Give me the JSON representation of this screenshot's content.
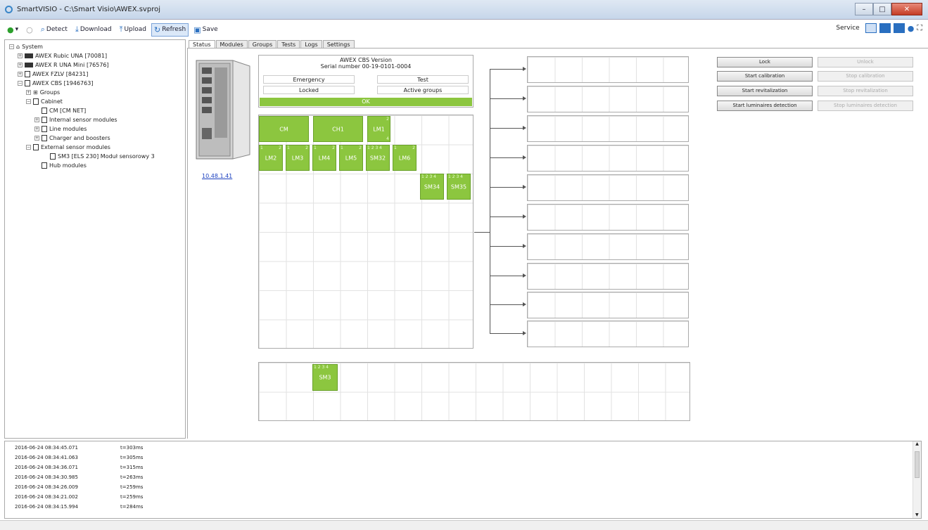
{
  "window": {
    "title": "SmartVISIO - C:\\Smart Visio\\AWEX.svproj"
  },
  "toolbar": {
    "buttons": [
      {
        "label": "",
        "icon": "add-icon"
      },
      {
        "label": "",
        "icon": "remove-icon"
      },
      {
        "label": "Detect",
        "icon": "detect-icon"
      },
      {
        "label": "Download",
        "icon": "download-icon"
      },
      {
        "label": "Upload",
        "icon": "upload-icon"
      },
      {
        "label": "Refresh",
        "icon": "refresh-icon"
      },
      {
        "label": "Save",
        "icon": "save-icon"
      }
    ],
    "service_label": "Service"
  },
  "tree": {
    "items": [
      {
        "label": "System"
      },
      {
        "label": "AWEX Rubic UNA [70081]"
      },
      {
        "label": "AWEX R UNA Mini [76576]"
      },
      {
        "label": "AWEX FZLV [84231]"
      },
      {
        "label": "AWEX CBS [1946763]"
      },
      {
        "label": "Groups"
      },
      {
        "label": "Cabinet"
      },
      {
        "label": "CM [CM NET]"
      },
      {
        "label": "Internal sensor modules"
      },
      {
        "label": "Line modules"
      },
      {
        "label": "Charger and boosters"
      },
      {
        "label": "External sensor modules"
      },
      {
        "label": "SM3 [ELS 230] Moduł sensorowy 3"
      },
      {
        "label": "Hub modules"
      }
    ]
  },
  "tabs": [
    "Status",
    "Modules",
    "Groups",
    "Tests",
    "Logs",
    "Settings"
  ],
  "status": {
    "device_line": "AWEX CBS   Version",
    "serial_line": "Serial number 00-19-0101-0004",
    "emergency": "Emergency",
    "test": "Test",
    "locked": "Locked",
    "active_groups": "Active groups",
    "ok": "OK",
    "ip": "10.48.1.41"
  },
  "modules": {
    "row1": [
      {
        "label": "CM",
        "tl": "",
        "tr": "",
        "br": ""
      },
      {
        "label": "CH1",
        "tl": "",
        "tr": "",
        "br": ""
      },
      {
        "label": "LM1",
        "tl": "",
        "tr": "2",
        "br": "4"
      }
    ],
    "row2": [
      {
        "label": "LM2",
        "tl": "1",
        "tr": "2"
      },
      {
        "label": "LM3",
        "tl": "1",
        "tr": "2"
      },
      {
        "label": "LM4",
        "tl": "1",
        "tr": "2"
      },
      {
        "label": "LM5",
        "tl": "1",
        "tr": "2"
      },
      {
        "label": "SM32",
        "tl": "1 2 3 4",
        "tr": ""
      },
      {
        "label": "LM6",
        "tl": "1",
        "tr": "2"
      }
    ],
    "row3": [
      {
        "label": "SM34",
        "tl": "1 2 3 4",
        "tr": ""
      },
      {
        "label": "SM35",
        "tl": "1 2 3 4",
        "tr": ""
      }
    ],
    "external": [
      {
        "label": "SM3",
        "tl": "1 2 3 4",
        "tr": ""
      }
    ]
  },
  "commands": [
    {
      "label": "Lock",
      "enabled": true
    },
    {
      "label": "Unlock",
      "enabled": false
    },
    {
      "label": "Start calibration",
      "enabled": true
    },
    {
      "label": "Stop calibration",
      "enabled": false
    },
    {
      "label": "Start revitalization",
      "enabled": true
    },
    {
      "label": "Stop revitalization",
      "enabled": false
    },
    {
      "label": "Start luminaires detection",
      "enabled": true
    },
    {
      "label": "Stop luminaires detection",
      "enabled": false
    }
  ],
  "log": [
    {
      "time": "2016-06-24 08:34:45.071",
      "value": "t=303ms"
    },
    {
      "time": "2016-06-24 08:34:41.063",
      "value": "t=305ms"
    },
    {
      "time": "2016-06-24 08:34:36.071",
      "value": "t=315ms"
    },
    {
      "time": "2016-06-24 08:34:30.985",
      "value": "t=263ms"
    },
    {
      "time": "2016-06-24 08:34:26.009",
      "value": "t=259ms"
    },
    {
      "time": "2016-06-24 08:34:21.002",
      "value": "t=259ms"
    },
    {
      "time": "2016-06-24 08:34:15.994",
      "value": "t=284ms"
    }
  ],
  "colors": {
    "module_green": "#8cc63f",
    "accent_blue": "#2a6fc0",
    "link": "#1a3fbf"
  }
}
